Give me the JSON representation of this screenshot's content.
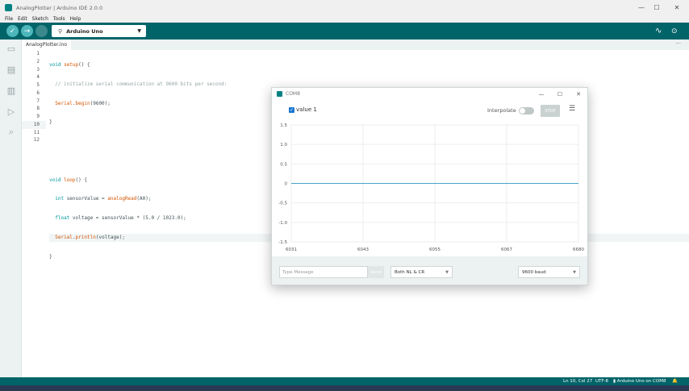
{
  "window": {
    "title": "AnalogPlotter | Arduino IDE 2.0.0"
  },
  "menu": [
    "File",
    "Edit",
    "Sketch",
    "Tools",
    "Help"
  ],
  "toolbar": {
    "board": "Arduino Uno"
  },
  "tab": {
    "filename": "AnalogPlotter.ino",
    "more": "···"
  },
  "editor": {
    "line_numbers": [
      "1",
      "2",
      "3",
      "4",
      "5",
      "6",
      "7",
      "8",
      "9",
      "10",
      "11",
      "12"
    ],
    "active_line": 10
  },
  "status": {
    "cursor": "Ln 10, Col 27",
    "encoding": "UTF-8",
    "board_port": "Arduino Uno on COM8"
  },
  "plotter": {
    "title": "COM8",
    "series_label": "value 1",
    "interpolate_label": "Interpolate",
    "stop_label": "STOP",
    "message_placeholder": "Type Message",
    "send_label": "Send",
    "line_ending": "Both NL & CR",
    "baud": "9600 baud",
    "colors": {
      "series": "#4aa3c9",
      "grid": "#eeeeee"
    }
  },
  "chart_data": {
    "type": "line",
    "x": [
      6031,
      6680
    ],
    "xticks": [
      "6031",
      "6043",
      "6055",
      "6067",
      "6680"
    ],
    "yticks": [
      "1.5",
      "1.0",
      "0.5",
      "0",
      "-0.5",
      "-1.0",
      "-1.5"
    ],
    "ylim": [
      -1.5,
      1.5
    ],
    "series": [
      {
        "name": "value 1",
        "values": [
          0,
          0
        ]
      }
    ]
  }
}
